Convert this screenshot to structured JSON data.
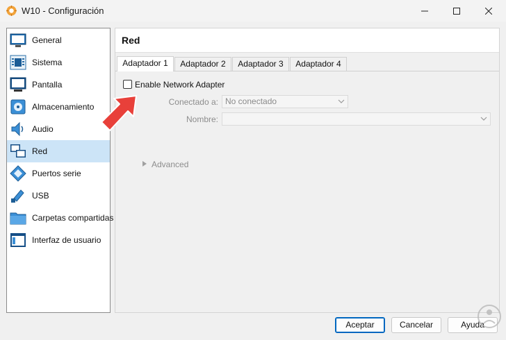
{
  "window": {
    "title": "W10 - Configuración"
  },
  "sidebar": {
    "items": [
      {
        "label": "General",
        "icon": "general-icon"
      },
      {
        "label": "Sistema",
        "icon": "system-icon"
      },
      {
        "label": "Pantalla",
        "icon": "display-icon"
      },
      {
        "label": "Almacenamiento",
        "icon": "storage-icon"
      },
      {
        "label": "Audio",
        "icon": "audio-icon"
      },
      {
        "label": "Red",
        "icon": "network-icon",
        "selected": true
      },
      {
        "label": "Puertos serie",
        "icon": "serial-ports-icon"
      },
      {
        "label": "USB",
        "icon": "usb-icon"
      },
      {
        "label": "Carpetas compartidas",
        "icon": "shared-folders-icon"
      },
      {
        "label": "Interfaz de usuario",
        "icon": "user-interface-icon"
      }
    ]
  },
  "section": {
    "title": "Red"
  },
  "tabs": [
    {
      "label": "Adaptador 1",
      "active": true
    },
    {
      "label": "Adaptador 2"
    },
    {
      "label": "Adaptador 3"
    },
    {
      "label": "Adaptador 4"
    }
  ],
  "adapter": {
    "enable_label": "Enable Network Adapter",
    "enabled": false,
    "attached_label": "Conectado a:",
    "attached_value": "No conectado",
    "name_label": "Nombre:",
    "name_value": "",
    "advanced_label": "Advanced"
  },
  "buttons": {
    "ok": "Aceptar",
    "cancel": "Cancelar",
    "help": "Ayuda"
  },
  "colors": {
    "selection": "#cce4f7",
    "accent": "#0067c0",
    "annotation_arrow": "#e8403a"
  }
}
